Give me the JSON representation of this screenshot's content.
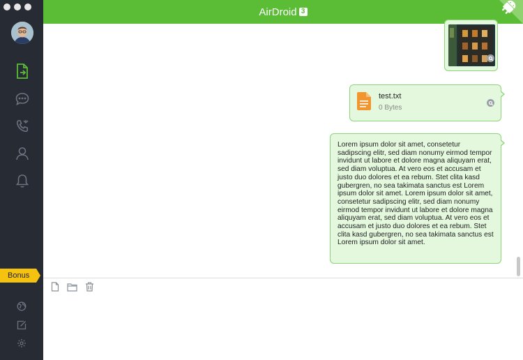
{
  "app": {
    "title": "AirDroid",
    "version_badge": "3"
  },
  "sidebar": {
    "items": [
      {
        "icon": "file-transfer-icon",
        "active": true
      },
      {
        "icon": "messages-icon",
        "active": false
      },
      {
        "icon": "calls-icon",
        "active": false
      },
      {
        "icon": "contacts-icon",
        "active": false
      },
      {
        "icon": "notifications-icon",
        "active": false
      }
    ],
    "bonus_label": "Bonus",
    "bottom_items": [
      "globe-icon",
      "edit-icon",
      "settings-icon"
    ]
  },
  "chat": {
    "file_message": {
      "name": "test.txt",
      "size": "0 Bytes"
    },
    "text_message": "Lorem ipsum dolor sit amet, consetetur sadipscing elitr, sed diam nonumy eirmod tempor invidunt ut labore et dolore magna aliquyam erat, sed diam voluptua. At vero eos et accusam et justo duo dolores et ea rebum. Stet clita kasd gubergren, no sea takimata sanctus est Lorem ipsum dolor sit amet. Lorem ipsum dolor sit amet, consetetur sadipscing elitr, sed diam nonumy eirmod tempor invidunt ut labore et dolore magna aliquyam erat, sed diam voluptua. At vero eos et accusam et justo duo dolores et ea rebum. Stet clita kasd gubergren, no sea takimata sanctus est Lorem ipsum dolor sit amet."
  },
  "composer": {
    "tools": [
      "file-icon",
      "folder-icon",
      "trash-icon"
    ],
    "value": ""
  },
  "colors": {
    "accent": "#5bbd35",
    "sidebar": "#262b34",
    "bubble": "#e3f8dd",
    "bonus": "#f5c30f"
  }
}
